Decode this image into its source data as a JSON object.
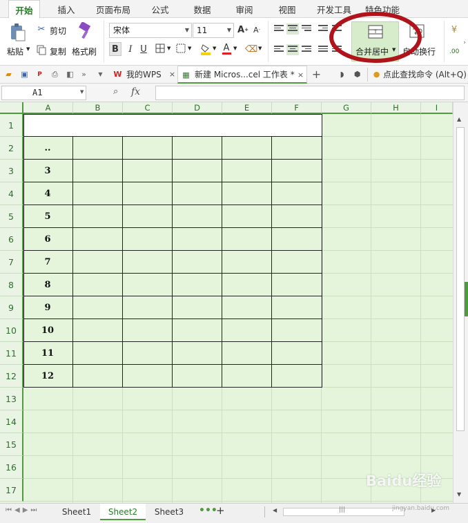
{
  "menu": {
    "tabs": [
      "开始",
      "插入",
      "页面布局",
      "公式",
      "数据",
      "审阅",
      "视图",
      "开发工具",
      "特色功能"
    ]
  },
  "ribbon": {
    "paste": "粘贴",
    "cut": "剪切",
    "copy": "复制",
    "format_painter": "格式刷",
    "font_name": "宋体",
    "font_size": "11",
    "merge_center": "合并居中",
    "auto_wrap": "自动换行",
    "number_format_hint": ".00"
  },
  "doc_tabs": {
    "wps_tab": "我的WPS",
    "file_tab": "新建 Micros...cel 工作表 *",
    "find_command": "点此查找命令 (Alt+Q)"
  },
  "formula_bar": {
    "cell_ref": "A1",
    "fx": "fx",
    "value": ""
  },
  "columns": [
    "A",
    "B",
    "C",
    "D",
    "E",
    "F",
    "G",
    "H",
    "I"
  ],
  "rows": [
    "1",
    "2",
    "3",
    "4",
    "5",
    "6",
    "7",
    "8",
    "9",
    "10",
    "11",
    "12",
    "13",
    "14",
    "15",
    "16",
    "17"
  ],
  "cells_a": [
    "..",
    "3",
    "4",
    "5",
    "6",
    "7",
    "8",
    "9",
    "10",
    "11",
    "12"
  ],
  "sheets": [
    "Sheet1",
    "Sheet2",
    "Sheet3"
  ],
  "active_sheet": "Sheet2",
  "watermark": "Baidu经验",
  "watermark_url": "jingyan.baidu.com",
  "colors": {
    "accent_green": "#2a7a2a",
    "grid_bg": "#e4f5dc",
    "highlight_circle": "#b0141a"
  }
}
